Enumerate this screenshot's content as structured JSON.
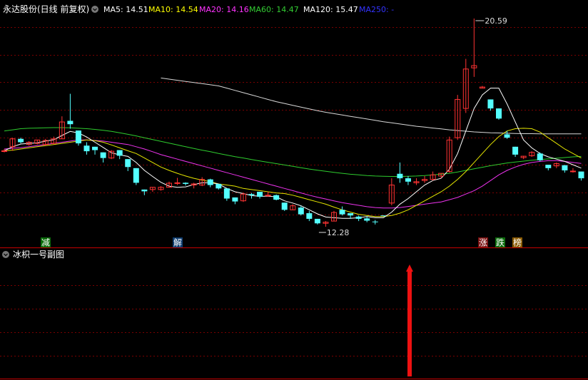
{
  "header": {
    "stock_title": "永达股份(日线 前复权)",
    "ma_items": [
      {
        "label": "MA5: 14.51",
        "color": "#ffffff"
      },
      {
        "label": "MA10: 14.54",
        "color": "#ffff00"
      },
      {
        "label": "MA20: 14.16",
        "color": "#ff33ff"
      },
      {
        "label": "MA60: 14.47",
        "color": "#33cc33"
      },
      {
        "label": "MA120: 15.47",
        "color": "#ffffff"
      },
      {
        "label": "MA250: -",
        "color": "#3333ff"
      }
    ]
  },
  "colors": {
    "background": "#000000",
    "grid": "#7a0000",
    "border": "#aa0000",
    "up": "#ff3333",
    "down": "#54ffff",
    "arrow": "#ee1111"
  },
  "main_panel": {
    "max_label": "20.59",
    "min_label": "12.28",
    "signals": [
      {
        "text": "减",
        "bg": "#0b6b0b",
        "fg": "#ffffff"
      },
      {
        "text": "解",
        "bg": "#0d3b6e",
        "fg": "#ffffff"
      },
      {
        "text": "涨",
        "bg": "#7a1010",
        "fg": "#ffffff"
      },
      {
        "text": "跌",
        "bg": "#0b6b0b",
        "fg": "#ffffff"
      },
      {
        "text": "榜",
        "bg": "#8a5a00",
        "fg": "#ffffff"
      }
    ]
  },
  "sub_panel": {
    "title": "冰枳一号副图"
  },
  "chart_data": {
    "type": "candlestick",
    "grid": true,
    "ohlc": [
      [
        14.72,
        14.8,
        14.65,
        14.72
      ],
      [
        14.9,
        15.3,
        14.72,
        15.25
      ],
      [
        15.25,
        15.3,
        15.05,
        15.1
      ],
      [
        15.0,
        15.15,
        14.95,
        15.1
      ],
      [
        15.05,
        15.2,
        15.0,
        15.2
      ],
      [
        15.0,
        15.25,
        14.95,
        15.18
      ],
      [
        15.05,
        15.35,
        15.0,
        15.25
      ],
      [
        15.25,
        16.25,
        15.25,
        16.0
      ],
      [
        16.05,
        17.25,
        15.7,
        15.9
      ],
      [
        15.62,
        15.62,
        14.95,
        15.05
      ],
      [
        14.95,
        15.1,
        14.55,
        14.7
      ],
      [
        14.9,
        14.9,
        14.55,
        14.75
      ],
      [
        14.65,
        14.65,
        14.2,
        14.4
      ],
      [
        14.4,
        14.75,
        14.35,
        14.7
      ],
      [
        14.75,
        14.75,
        14.35,
        14.5
      ],
      [
        14.35,
        14.35,
        13.82,
        14.0
      ],
      [
        13.95,
        13.95,
        13.2,
        13.3
      ],
      [
        13.0,
        13.0,
        12.75,
        12.92
      ],
      [
        13.0,
        13.1,
        12.9,
        13.1
      ],
      [
        13.0,
        13.15,
        12.95,
        13.1
      ],
      [
        13.1,
        13.35,
        13.1,
        13.28
      ],
      [
        13.28,
        13.52,
        13.2,
        13.3
      ],
      [
        13.3,
        13.32,
        13.18,
        13.25
      ],
      [
        13.2,
        13.3,
        13.05,
        13.25
      ],
      [
        13.2,
        13.55,
        13.15,
        13.45
      ],
      [
        13.45,
        13.48,
        13.1,
        13.2
      ],
      [
        13.25,
        13.25,
        13.0,
        13.05
      ],
      [
        13.05,
        13.05,
        12.5,
        12.6
      ],
      [
        12.65,
        12.65,
        12.35,
        12.47
      ],
      [
        12.5,
        12.85,
        12.45,
        12.8
      ],
      [
        12.8,
        12.85,
        12.6,
        12.75
      ],
      [
        12.9,
        12.9,
        12.6,
        12.68
      ],
      [
        12.75,
        12.9,
        12.68,
        12.75
      ],
      [
        12.75,
        12.78,
        12.52,
        12.55
      ],
      [
        12.42,
        12.42,
        12.05,
        12.1
      ],
      [
        12.1,
        12.35,
        12.1,
        12.28
      ],
      [
        12.2,
        12.28,
        11.85,
        11.9
      ],
      [
        11.95,
        12.05,
        11.6,
        11.7
      ],
      [
        11.7,
        11.7,
        11.45,
        11.5
      ],
      [
        11.5,
        11.6,
        11.35,
        11.55
      ],
      [
        11.6,
        12.05,
        11.6,
        11.98
      ],
      [
        12.1,
        12.25,
        11.85,
        11.9
      ],
      [
        11.95,
        11.95,
        11.7,
        11.85
      ],
      [
        11.8,
        11.85,
        11.6,
        11.7
      ],
      [
        11.72,
        11.82,
        11.55,
        11.62
      ],
      [
        11.58,
        11.65,
        11.45,
        11.55
      ],
      [
        11.85,
        11.85,
        11.82,
        11.83
      ],
      [
        12.4,
        13.5,
        12.3,
        13.2
      ],
      [
        13.7,
        14.2,
        13.3,
        13.5
      ],
      [
        13.5,
        13.6,
        13.2,
        13.35
      ],
      [
        13.3,
        13.5,
        13.2,
        13.35
      ],
      [
        13.4,
        13.6,
        13.3,
        13.45
      ],
      [
        13.45,
        13.8,
        13.4,
        13.65
      ],
      [
        13.6,
        13.72,
        13.5,
        13.72
      ],
      [
        13.8,
        15.35,
        13.75,
        15.2
      ],
      [
        15.3,
        17.2,
        15.2,
        17.0
      ],
      [
        16.6,
        18.8,
        16.4,
        18.35
      ],
      [
        18.4,
        20.59,
        18.0,
        18.5
      ],
      [
        17.5,
        17.6,
        17.5,
        17.55
      ],
      [
        17.0,
        17.0,
        16.5,
        16.6
      ],
      [
        16.6,
        16.6,
        16.1,
        16.15
      ],
      [
        15.45,
        15.6,
        15.25,
        15.3
      ],
      [
        14.9,
        14.9,
        14.45,
        14.55
      ],
      [
        14.42,
        14.5,
        14.35,
        14.48
      ],
      [
        14.5,
        14.7,
        14.45,
        14.65
      ],
      [
        14.6,
        14.65,
        14.25,
        14.3
      ],
      [
        14.1,
        14.1,
        13.85,
        13.95
      ],
      [
        14.05,
        14.2,
        13.95,
        14.15
      ],
      [
        14.08,
        14.08,
        13.75,
        13.85
      ],
      [
        13.82,
        13.95,
        13.75,
        13.82
      ],
      [
        13.8,
        13.8,
        13.4,
        13.5
      ]
    ],
    "ma5": [
      14.72,
      14.9,
      15.02,
      15.05,
      15.07,
      15.15,
      15.21,
      15.4,
      15.58,
      15.51,
      15.33,
      15.1,
      14.87,
      14.63,
      14.54,
      14.47,
      14.2,
      13.85,
      13.58,
      13.32,
      13.15,
      13.1,
      13.12,
      13.22,
      13.3,
      13.3,
      13.25,
      13.05,
      12.9,
      12.82,
      12.73,
      12.7,
      12.7,
      12.68,
      12.5,
      12.4,
      12.28,
      12.1,
      11.92,
      11.78,
      11.75,
      11.72,
      11.72,
      11.75,
      11.8,
      11.75,
      11.75,
      12.0,
      12.35,
      12.6,
      12.9,
      13.2,
      13.4,
      13.5,
      13.9,
      14.6,
      15.6,
      16.6,
      17.2,
      17.5,
      17.5,
      16.8,
      16.0,
      15.2,
      14.85,
      14.6,
      14.45,
      14.35,
      14.25,
      14.1,
      13.95
    ],
    "ma10": [
      14.72,
      14.75,
      14.8,
      14.85,
      14.9,
      14.95,
      15.0,
      15.05,
      15.1,
      15.15,
      15.2,
      15.17,
      15.1,
      14.98,
      14.85,
      14.72,
      14.6,
      14.4,
      14.2,
      14.0,
      13.85,
      13.72,
      13.6,
      13.5,
      13.42,
      13.35,
      13.25,
      13.2,
      13.15,
      13.05,
      13.0,
      12.95,
      12.9,
      12.85,
      12.82,
      12.75,
      12.65,
      12.55,
      12.45,
      12.35,
      12.22,
      12.1,
      12.0,
      11.9,
      11.85,
      11.8,
      11.8,
      11.85,
      11.95,
      12.1,
      12.3,
      12.5,
      12.7,
      12.9,
      13.15,
      13.45,
      13.8,
      14.2,
      14.6,
      15.0,
      15.35,
      15.6,
      15.7,
      15.72,
      15.7,
      15.55,
      15.3,
      15.05,
      14.8,
      14.6,
      14.4
    ],
    "ma20": [
      14.8,
      14.83,
      14.86,
      14.9,
      14.95,
      15.0,
      15.05,
      15.1,
      15.15,
      15.2,
      15.2,
      15.18,
      15.15,
      15.1,
      15.05,
      15.0,
      14.9,
      14.8,
      14.68,
      14.55,
      14.45,
      14.35,
      14.25,
      14.15,
      14.05,
      13.95,
      13.85,
      13.75,
      13.65,
      13.55,
      13.45,
      13.35,
      13.25,
      13.15,
      13.05,
      12.95,
      12.85,
      12.75,
      12.66,
      12.58,
      12.5,
      12.42,
      12.36,
      12.3,
      12.24,
      12.2,
      12.18,
      12.18,
      12.2,
      12.25,
      12.3,
      12.35,
      12.4,
      12.45,
      12.55,
      12.65,
      12.8,
      12.95,
      13.15,
      13.4,
      13.65,
      13.85,
      14.0,
      14.12,
      14.2,
      14.25,
      14.28,
      14.28,
      14.25,
      14.2,
      14.16
    ],
    "ma60": [
      15.6,
      15.65,
      15.7,
      15.72,
      15.73,
      15.74,
      15.75,
      15.75,
      15.74,
      15.72,
      15.7,
      15.67,
      15.63,
      15.58,
      15.52,
      15.45,
      15.38,
      15.3,
      15.22,
      15.14,
      15.06,
      14.98,
      14.9,
      14.82,
      14.75,
      14.68,
      14.6,
      14.53,
      14.46,
      14.4,
      14.33,
      14.27,
      14.21,
      14.15,
      14.09,
      14.03,
      13.97,
      13.91,
      13.86,
      13.81,
      13.76,
      13.72,
      13.68,
      13.65,
      13.62,
      13.6,
      13.59,
      13.58,
      13.58,
      13.59,
      13.6,
      13.62,
      13.65,
      13.68,
      13.72,
      13.78,
      13.85,
      13.92,
      13.99,
      14.06,
      14.12,
      14.18,
      14.22,
      14.26,
      14.3,
      14.33,
      14.36,
      14.39,
      14.42,
      14.45,
      14.47
    ],
    "ma120_start": 19,
    "ma120": [
      17.95,
      17.9,
      17.85,
      17.8,
      17.75,
      17.7,
      17.65,
      17.6,
      17.5,
      17.4,
      17.3,
      17.2,
      17.1,
      17.0,
      16.9,
      16.82,
      16.74,
      16.66,
      16.58,
      16.5,
      16.43,
      16.37,
      16.31,
      16.25,
      16.19,
      16.13,
      16.07,
      16.01,
      15.96,
      15.91,
      15.86,
      15.81,
      15.77,
      15.73,
      15.69,
      15.65,
      15.62,
      15.59,
      15.56,
      15.54,
      15.52,
      15.51,
      15.5,
      15.49,
      15.48,
      15.48,
      15.47,
      15.47,
      15.47,
      15.47,
      15.47,
      15.47
    ],
    "volume_signal_index": 47,
    "max_index": 57,
    "min_index": 38
  }
}
